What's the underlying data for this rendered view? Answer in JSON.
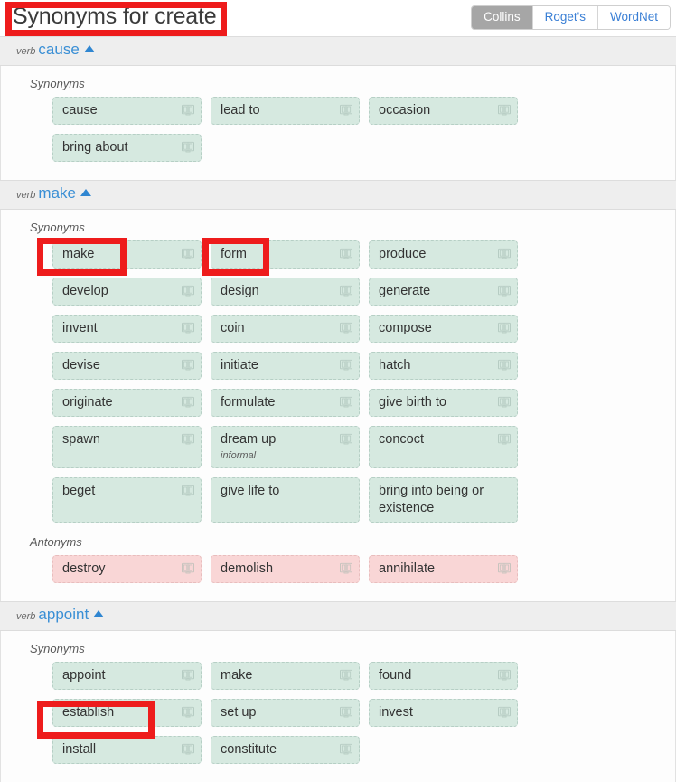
{
  "header": {
    "title": "Synonyms for create",
    "tabs": [
      {
        "label": "Collins",
        "active": true
      },
      {
        "label": "Roget's",
        "active": false
      },
      {
        "label": "WordNet",
        "active": false
      }
    ]
  },
  "labels": {
    "pos": "verb",
    "synonyms": "Synonyms",
    "antonyms": "Antonyms",
    "book_icon": "book-icon",
    "collapse_icon": "caret-up-icon"
  },
  "senses": [
    {
      "pos": "verb",
      "word": "cause",
      "synonyms": [
        {
          "word": "cause",
          "icon": true
        },
        {
          "word": "lead to",
          "icon": true
        },
        {
          "word": "occasion",
          "icon": true
        },
        {
          "word": "bring about",
          "icon": true
        }
      ],
      "antonyms": []
    },
    {
      "pos": "verb",
      "word": "make",
      "synonyms": [
        {
          "word": "make",
          "icon": true
        },
        {
          "word": "form",
          "icon": true
        },
        {
          "word": "produce",
          "icon": true
        },
        {
          "word": "develop",
          "icon": true
        },
        {
          "word": "design",
          "icon": true
        },
        {
          "word": "generate",
          "icon": true
        },
        {
          "word": "invent",
          "icon": true
        },
        {
          "word": "coin",
          "icon": true
        },
        {
          "word": "compose",
          "icon": true
        },
        {
          "word": "devise",
          "icon": true
        },
        {
          "word": "initiate",
          "icon": true
        },
        {
          "word": "hatch",
          "icon": true
        },
        {
          "word": "originate",
          "icon": true
        },
        {
          "word": "formulate",
          "icon": true
        },
        {
          "word": "give birth to",
          "icon": true
        },
        {
          "word": "spawn",
          "icon": true
        },
        {
          "word": "dream up",
          "icon": true,
          "tag": "informal"
        },
        {
          "word": "concoct",
          "icon": true
        },
        {
          "word": "beget",
          "icon": true
        },
        {
          "word": "give life to",
          "icon": false
        },
        {
          "word": "bring into being or existence",
          "icon": false
        }
      ],
      "antonyms": [
        {
          "word": "destroy",
          "icon": true
        },
        {
          "word": "demolish",
          "icon": true
        },
        {
          "word": "annihilate",
          "icon": true
        }
      ]
    },
    {
      "pos": "verb",
      "word": "appoint",
      "synonyms": [
        {
          "word": "appoint",
          "icon": true
        },
        {
          "word": "make",
          "icon": true
        },
        {
          "word": "found",
          "icon": true
        },
        {
          "word": "establish",
          "icon": true
        },
        {
          "word": "set up",
          "icon": true
        },
        {
          "word": "invest",
          "icon": true
        },
        {
          "word": "install",
          "icon": true
        },
        {
          "word": "constitute",
          "icon": true
        }
      ],
      "antonyms": []
    }
  ],
  "annotations": [
    {
      "name": "page-title-highlight",
      "color": "#ee1c1c"
    },
    {
      "name": "make-chip-highlight",
      "color": "#ee1c1c"
    },
    {
      "name": "form-chip-highlight",
      "color": "#ee1c1c"
    },
    {
      "name": "establish-chip-highlight",
      "color": "#ee1c1c"
    }
  ]
}
